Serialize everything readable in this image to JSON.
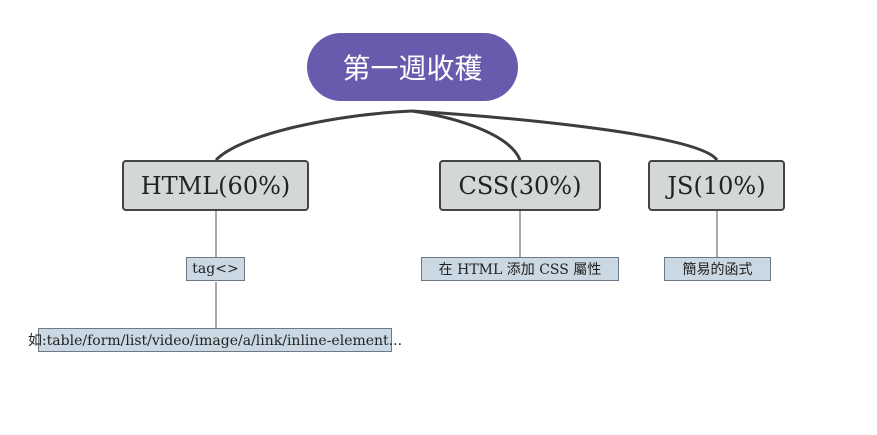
{
  "mindmap": {
    "root": {
      "label": "第一週收穫",
      "color": "#6a5aad"
    },
    "branches": [
      {
        "label": "HTML(60%)"
      },
      {
        "label": "CSS(30%)"
      },
      {
        "label": "JS(10%)"
      }
    ],
    "leaves": {
      "html_tag": "tag<>",
      "html_examples": "如:table/form/list/video/image/a/link/inline-element...",
      "css": "在 HTML 添加 CSS 屬性",
      "js": "簡易的函式"
    }
  }
}
